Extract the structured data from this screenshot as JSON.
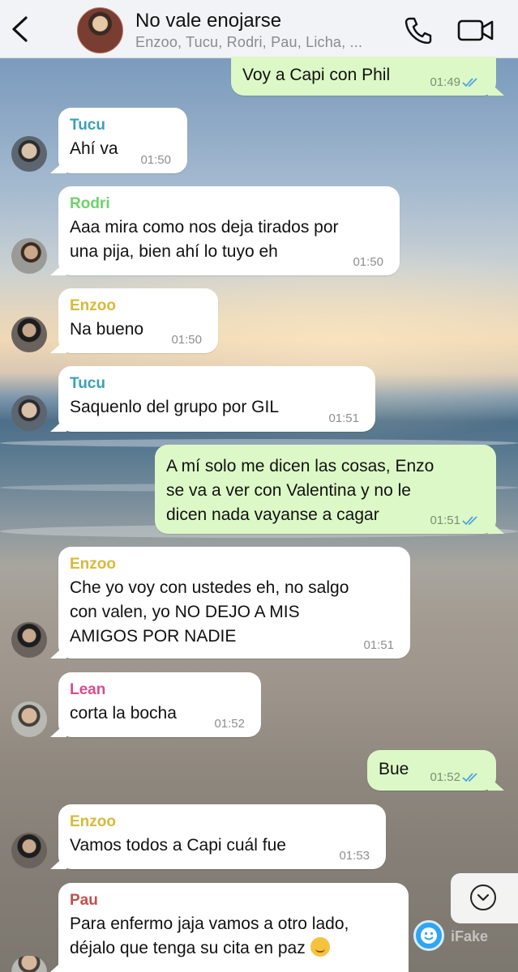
{
  "header": {
    "title": "No vale enojarse",
    "subtitle": "Enzoo, Tucu, Rodri, Pau, Licha, ..."
  },
  "colors": {
    "tucu": "#3aa0b8",
    "rodri": "#6cd36a",
    "enzoo": "#d9b93a",
    "lean": "#d64c8f",
    "pau": "#c0504d",
    "outgoing_bubble": "#dcf8c6",
    "tick": "#4fa3e0"
  },
  "messages": [
    {
      "dir": "out",
      "text": [
        "Voy a Capi con Phil"
      ],
      "time": "01:49"
    },
    {
      "dir": "in",
      "sender": "Tucu",
      "text": [
        "Ahí va"
      ],
      "time": "01:50"
    },
    {
      "dir": "in",
      "sender": "Rodri",
      "text": [
        "Aaa mira como nos deja tirados por",
        "una pija, bien ahí lo tuyo eh"
      ],
      "time": "01:50"
    },
    {
      "dir": "in",
      "sender": "Enzoo",
      "text": [
        "Na bueno"
      ],
      "time": "01:50"
    },
    {
      "dir": "in",
      "sender": "Tucu",
      "text": [
        "Saquenlo del grupo por GIL"
      ],
      "time": "01:51"
    },
    {
      "dir": "out",
      "text": [
        "A mí solo me dicen las cosas, Enzo",
        "se va a ver con Valentina y no le",
        "dicen nada vayanse a cagar"
      ],
      "time": "01:51"
    },
    {
      "dir": "in",
      "sender": "Enzoo",
      "text": [
        "Che yo voy con ustedes eh, no salgo",
        "con valen, yo NO DEJO A MIS",
        "AMIGOS POR NADIE"
      ],
      "time": "01:51"
    },
    {
      "dir": "in",
      "sender": "Lean",
      "text": [
        "corta la bocha"
      ],
      "time": "01:52"
    },
    {
      "dir": "out",
      "text": [
        "Bue"
      ],
      "time": "01:52"
    },
    {
      "dir": "in",
      "sender": "Enzoo",
      "text": [
        "Vamos todos a Capi cuál fue"
      ],
      "time": "01:53"
    },
    {
      "dir": "in",
      "sender": "Pau",
      "text": [
        "Para enfermo jaja vamos a otro lado,",
        "déjalo que tenga su cita en paz"
      ]
    }
  ],
  "watermark": "iFake",
  "icons": [
    "back-chevron",
    "phone",
    "video-camera",
    "read-ticks",
    "scroll-down-chevron",
    "emoji"
  ]
}
